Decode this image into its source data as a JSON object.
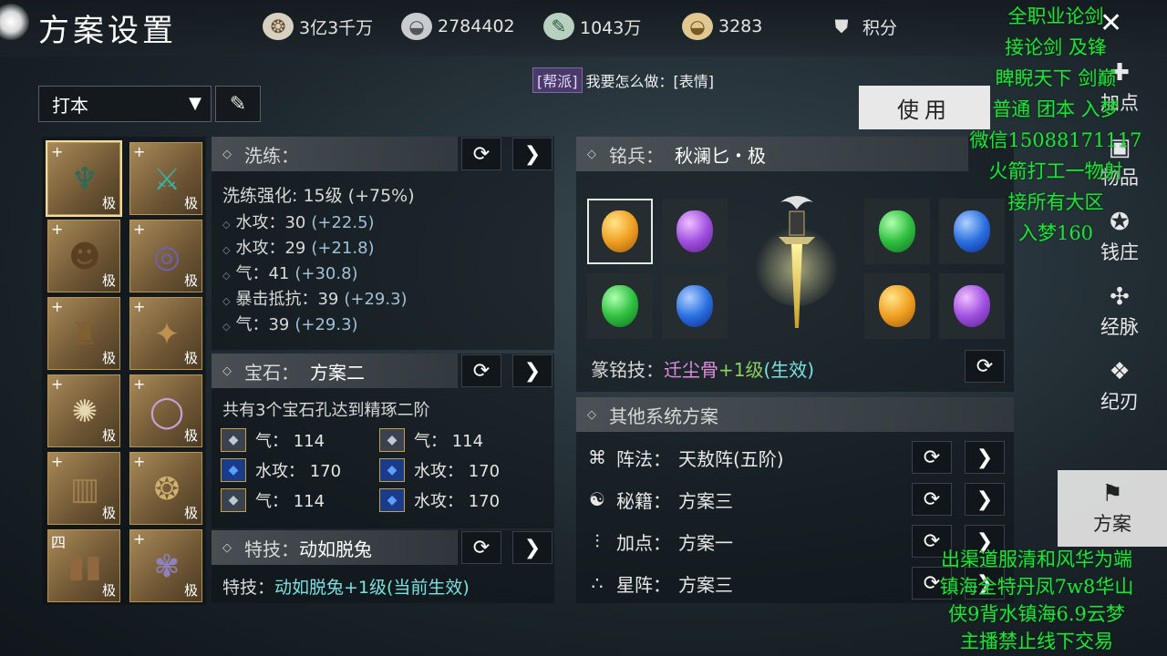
{
  "header": {
    "title": "方案设置",
    "currencies": [
      {
        "icon": "coin-wheel-icon",
        "value": "3亿3千万"
      },
      {
        "icon": "silver-ingot-icon",
        "value": "2784402"
      },
      {
        "icon": "jade-ticket-icon",
        "value": "1043万"
      },
      {
        "icon": "gold-ingot-icon",
        "value": "3283"
      },
      {
        "icon": "points-shield-icon",
        "value": "积分"
      }
    ]
  },
  "chat": {
    "channel": "[帮派]",
    "message": "我要怎么做：[表情]"
  },
  "preset": {
    "selected": "打本"
  },
  "equipment": {
    "grade": "极",
    "slots": [
      {
        "art": "♆",
        "color": "#2a6a5a",
        "mark": "+"
      },
      {
        "art": "⚔",
        "color": "#3ab0a0",
        "mark": "+"
      },
      {
        "art": "☻",
        "color": "#5a4020",
        "mark": "+"
      },
      {
        "art": "◎",
        "color": "#7060b0",
        "mark": "+"
      },
      {
        "art": "♜",
        "color": "#806030",
        "mark": "+"
      },
      {
        "art": "✦",
        "color": "#c09050",
        "mark": "+"
      },
      {
        "art": "✺",
        "color": "#e8d8b0",
        "mark": "+"
      },
      {
        "art": "◯",
        "color": "#c8a0d8",
        "mark": "+"
      },
      {
        "art": "▥",
        "color": "#a08050",
        "mark": "+"
      },
      {
        "art": "❂",
        "color": "#d0b070",
        "mark": "+"
      },
      {
        "art": "▮▮",
        "color": "#906840",
        "mark": "四"
      },
      {
        "art": "✾",
        "color": "#9080c0",
        "mark": "+"
      }
    ]
  },
  "refine": {
    "label": "洗练：",
    "strength": "洗练强化: 15级 (+75%)",
    "stats": [
      {
        "name": "水攻：",
        "value": "30",
        "bonus": "(+22.5)"
      },
      {
        "name": "水攻：",
        "value": "29",
        "bonus": "(+21.8)"
      },
      {
        "name": "气：",
        "value": "41",
        "bonus": "(+30.8)"
      },
      {
        "name": "暴击抵抗：",
        "value": "39",
        "bonus": "(+29.3)"
      },
      {
        "name": "气：",
        "value": "39",
        "bonus": "(+29.3)"
      }
    ]
  },
  "gems": {
    "label": "宝石：",
    "value": "方案二",
    "summary": "共有3个宝石孔达到精琢二阶",
    "items": [
      {
        "type": "grey",
        "text": "气：  114"
      },
      {
        "type": "grey",
        "text": "气：  114"
      },
      {
        "type": "blue",
        "text": "水攻：  170"
      },
      {
        "type": "blue",
        "text": "水攻：  170"
      },
      {
        "type": "grey",
        "text": "气：  114"
      },
      {
        "type": "blue",
        "text": "水攻：  170"
      }
    ]
  },
  "skill": {
    "label": "特技：",
    "value": "动如脱兔",
    "desc_prefix": "特技：",
    "desc_value": "动如脱兔+1级(当前生效)"
  },
  "weapon": {
    "label": "铭兵：",
    "name": "秋澜匕・极",
    "gems_left": [
      "g-orange",
      "g-purple",
      "g-green",
      "g-blue"
    ],
    "gems_right": [
      "g-green",
      "g-blue",
      "g-orange",
      "g-purple"
    ],
    "engrave_label": "篆铭技：",
    "engrave_name": "迁尘骨",
    "engrave_level": "+1级",
    "engrave_status": "(生效)"
  },
  "use_button": "使用",
  "other_systems": {
    "title": "其他系统方案",
    "rows": [
      {
        "icon": "formation-icon",
        "glyph": "⌘",
        "label": "阵法：",
        "value": "天敖阵(五阶)"
      },
      {
        "icon": "meditation-icon",
        "glyph": "☯",
        "label": "秘籍：",
        "value": "方案三"
      },
      {
        "icon": "sliders-icon",
        "glyph": "⫶",
        "label": "加点：",
        "value": "方案一"
      },
      {
        "icon": "constellation-icon",
        "glyph": "∴",
        "label": "星阵：",
        "value": "方案三"
      }
    ]
  },
  "sidenav": {
    "items": [
      {
        "label": "加点",
        "icon": "✚"
      },
      {
        "label": "物品",
        "icon": "▣"
      },
      {
        "label": "钱庄",
        "icon": "✪"
      },
      {
        "label": "经脉",
        "icon": "✣"
      },
      {
        "label": "纪刃",
        "icon": "❖"
      },
      {
        "label": "方案",
        "icon": "⚑"
      }
    ]
  },
  "stream_overlay": {
    "top_lines": [
      "全职业论剑",
      "接论剑 及锋",
      "睥睨天下 剑巅",
      "普通 团本 入梦",
      "微信15088171117",
      "火箭打工一物射",
      "接所有大区",
      "入梦160"
    ],
    "bottom_lines": [
      "出渠道服清和风华为端",
      "镇海全特丹凤7w8华山",
      "侠9背水镇海6.9云梦",
      "主播禁止线下交易"
    ]
  }
}
